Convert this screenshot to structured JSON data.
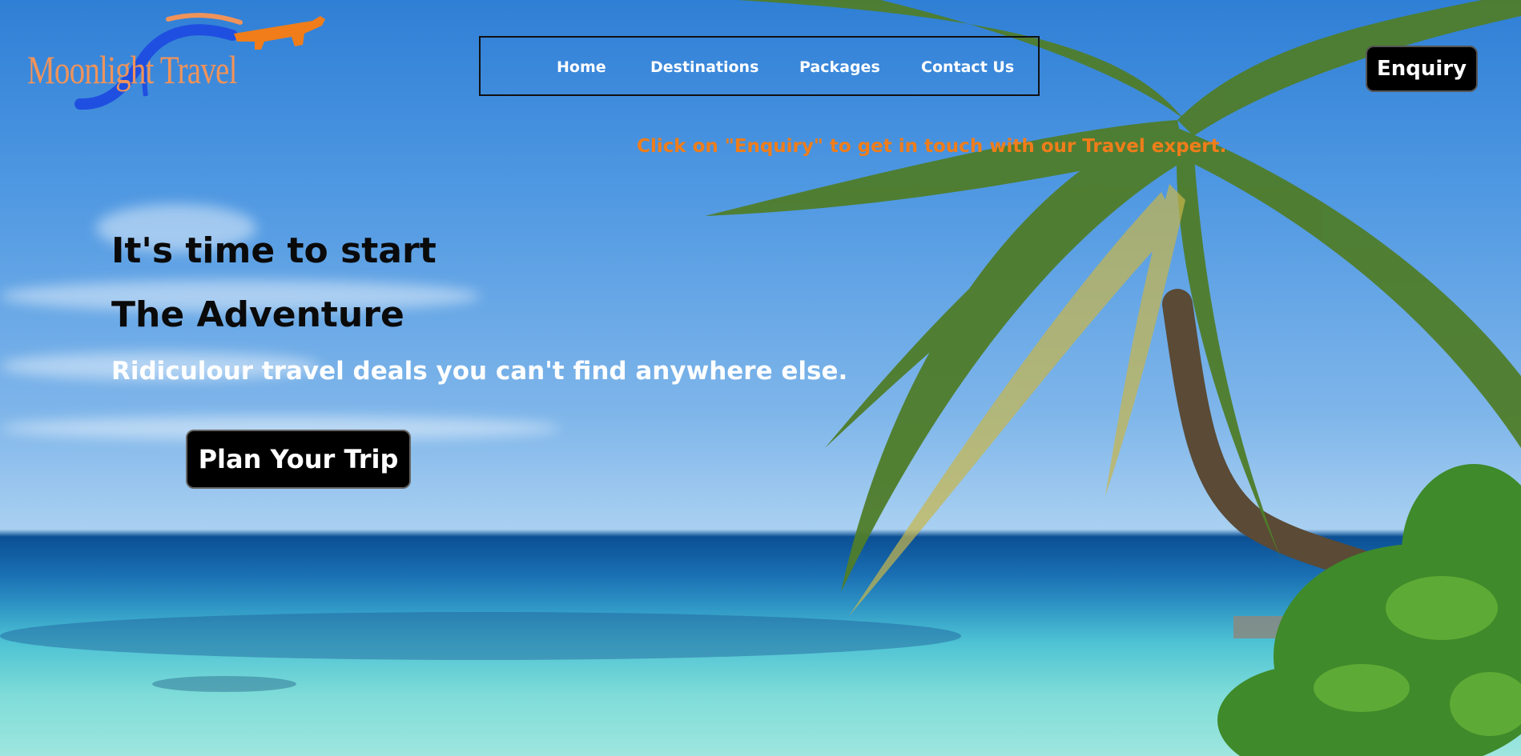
{
  "brand": {
    "logo_text": "Moonlight Travel"
  },
  "nav": {
    "items": [
      {
        "label": "Home"
      },
      {
        "label": "Destinations"
      },
      {
        "label": "Packages"
      },
      {
        "label": "Contact Us"
      }
    ]
  },
  "header": {
    "enquiry_label": "Enquiry"
  },
  "notice": {
    "text": "Click on \"Enquiry\" to get in touch with our Travel expert."
  },
  "hero": {
    "headline_line1": "It's time to start",
    "headline_line2": "The Adventure",
    "tagline": "Ridiculour travel deals you can't find anywhere else.",
    "cta_label": "Plan Your Trip"
  },
  "colors": {
    "accent_orange": "#f07d1a",
    "logo_blue": "#1f4fe0",
    "button_bg": "#000000",
    "sky": "#4f98e2",
    "sea": "#1a6fb3"
  },
  "icons": {
    "logo_mark": "airplane-arc-icon"
  }
}
